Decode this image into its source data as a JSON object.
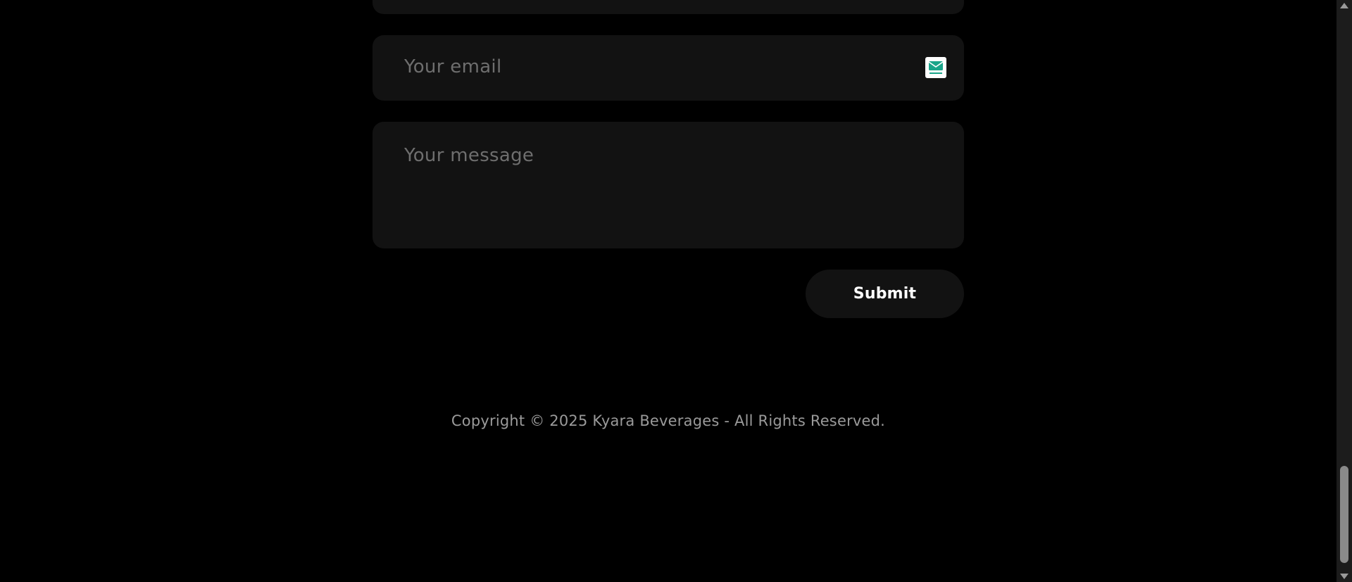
{
  "form": {
    "email_placeholder": "Your email",
    "message_placeholder": "Your message",
    "submit_label": "Submit"
  },
  "footer": {
    "copyright": "Copyright © 2025 Kyara Beverages - All Rights Reserved."
  },
  "icons": {
    "email_field_icon": "temp-mail-envelope-icon"
  },
  "colors": {
    "background": "#000000",
    "field_background": "#121212",
    "placeholder": "#6e6e6e",
    "button_text": "#ffffff",
    "copyright_text": "#9a9a9a",
    "icon_accent": "#1aa58a"
  }
}
